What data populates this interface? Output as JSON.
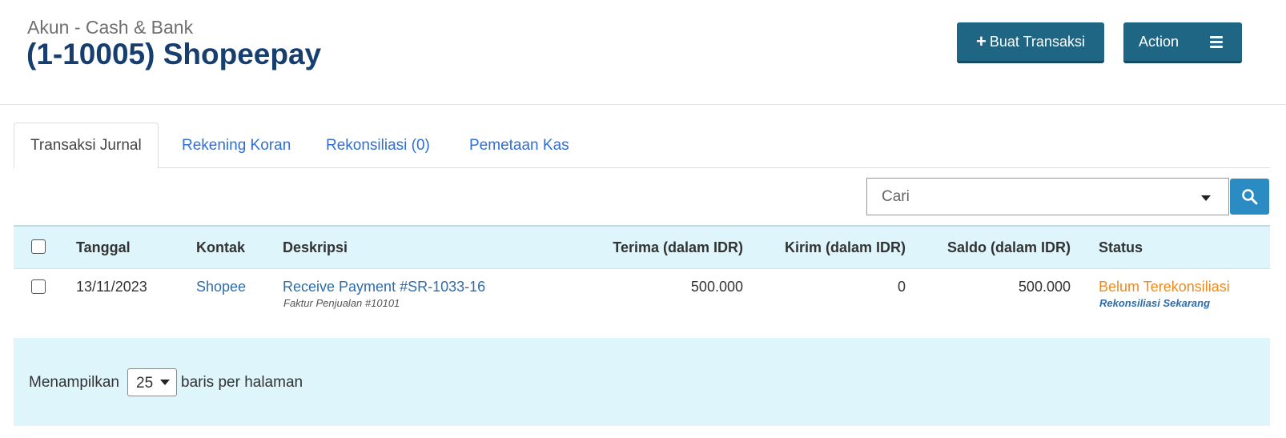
{
  "header": {
    "subtitle": "Akun - Cash & Bank",
    "title": "(1-10005) Shopeepay",
    "create_button": "Buat Transaksi",
    "action_button": "Action"
  },
  "tabs": [
    {
      "label": "Transaksi Jurnal",
      "active": true
    },
    {
      "label": "Rekening Koran",
      "active": false
    },
    {
      "label": "Rekonsiliasi (0)",
      "active": false
    },
    {
      "label": "Pemetaan Kas",
      "active": false
    }
  ],
  "search": {
    "placeholder": "Cari"
  },
  "table": {
    "columns": {
      "date": "Tanggal",
      "contact": "Kontak",
      "description": "Deskripsi",
      "receive": "Terima (dalam IDR)",
      "send": "Kirim (dalam IDR)",
      "balance": "Saldo (dalam IDR)",
      "status": "Status"
    },
    "rows": [
      {
        "date": "13/11/2023",
        "contact": "Shopee",
        "description": "Receive Payment #SR-1033-16",
        "description_sub": "Faktur Penjualan #10101",
        "receive": "500.000",
        "send": "0",
        "balance": "500.000",
        "status": "Belum Terekonsiliasi",
        "status_action": "Rekonsiliasi Sekarang"
      }
    ]
  },
  "pagination": {
    "prefix": "Menampilkan",
    "per_page": "25",
    "suffix": "baris per halaman"
  },
  "colors": {
    "title": "#163e6e",
    "button": "#1f6584",
    "link": "#2f6ca8",
    "status_warning": "#f08a1d",
    "table_header_bg": "#ddf5fb"
  }
}
